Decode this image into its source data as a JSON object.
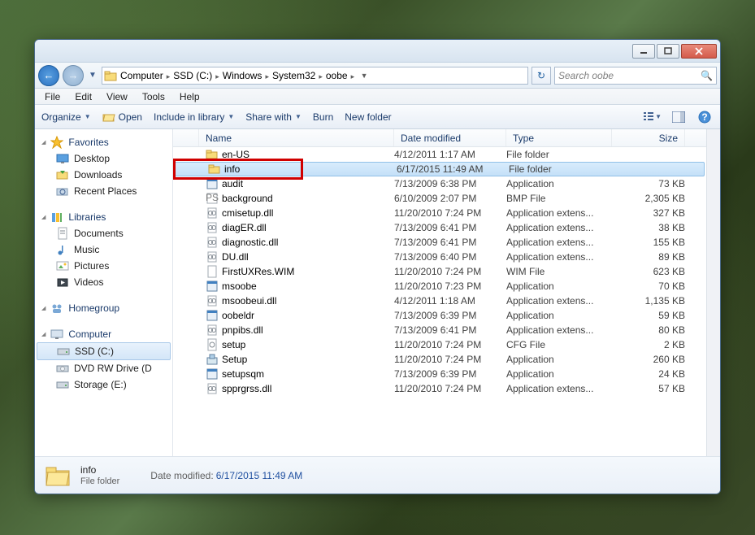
{
  "breadcrumb": [
    "Computer",
    "SSD (C:)",
    "Windows",
    "System32",
    "oobe"
  ],
  "search": {
    "placeholder": "Search oobe"
  },
  "menu": [
    "File",
    "Edit",
    "View",
    "Tools",
    "Help"
  ],
  "toolbar": {
    "organize": "Organize",
    "open": "Open",
    "include": "Include in library",
    "share": "Share with",
    "burn": "Burn",
    "newfolder": "New folder"
  },
  "columns": {
    "name": "Name",
    "date": "Date modified",
    "type": "Type",
    "size": "Size"
  },
  "sidebar": {
    "favorites": {
      "label": "Favorites",
      "items": [
        {
          "label": "Desktop",
          "icon": "desktop"
        },
        {
          "label": "Downloads",
          "icon": "downloads"
        },
        {
          "label": "Recent Places",
          "icon": "recent"
        }
      ]
    },
    "libraries": {
      "label": "Libraries",
      "items": [
        {
          "label": "Documents",
          "icon": "documents"
        },
        {
          "label": "Music",
          "icon": "music"
        },
        {
          "label": "Pictures",
          "icon": "pictures"
        },
        {
          "label": "Videos",
          "icon": "videos"
        }
      ]
    },
    "homegroup": {
      "label": "Homegroup"
    },
    "computer": {
      "label": "Computer",
      "items": [
        {
          "label": "SSD (C:)",
          "icon": "drive",
          "selected": true
        },
        {
          "label": "DVD RW Drive (D",
          "icon": "dvd"
        },
        {
          "label": "Storage (E:)",
          "icon": "drive"
        }
      ]
    }
  },
  "files": [
    {
      "name": "en-US",
      "date": "4/12/2011 1:17 AM",
      "type": "File folder",
      "size": "",
      "icon": "folder"
    },
    {
      "name": "info",
      "date": "6/17/2015 11:49 AM",
      "type": "File folder",
      "size": "",
      "icon": "folder",
      "selected": true
    },
    {
      "name": "audit",
      "date": "7/13/2009 6:38 PM",
      "type": "Application",
      "size": "73 KB",
      "icon": "app"
    },
    {
      "name": "background",
      "date": "6/10/2009 2:07 PM",
      "type": "BMP File",
      "size": "2,305 KB",
      "icon": "bmp"
    },
    {
      "name": "cmisetup.dll",
      "date": "11/20/2010 7:24 PM",
      "type": "Application extens...",
      "size": "327 KB",
      "icon": "dll"
    },
    {
      "name": "diagER.dll",
      "date": "7/13/2009 6:41 PM",
      "type": "Application extens...",
      "size": "38 KB",
      "icon": "dll"
    },
    {
      "name": "diagnostic.dll",
      "date": "7/13/2009 6:41 PM",
      "type": "Application extens...",
      "size": "155 KB",
      "icon": "dll"
    },
    {
      "name": "DU.dll",
      "date": "7/13/2009 6:40 PM",
      "type": "Application extens...",
      "size": "89 KB",
      "icon": "dll"
    },
    {
      "name": "FirstUXRes.WIM",
      "date": "11/20/2010 7:24 PM",
      "type": "WIM File",
      "size": "623 KB",
      "icon": "file"
    },
    {
      "name": "msoobe",
      "date": "11/20/2010 7:23 PM",
      "type": "Application",
      "size": "70 KB",
      "icon": "app"
    },
    {
      "name": "msoobeui.dll",
      "date": "4/12/2011 1:18 AM",
      "type": "Application extens...",
      "size": "1,135 KB",
      "icon": "dll"
    },
    {
      "name": "oobeldr",
      "date": "7/13/2009 6:39 PM",
      "type": "Application",
      "size": "59 KB",
      "icon": "app"
    },
    {
      "name": "pnpibs.dll",
      "date": "7/13/2009 6:41 PM",
      "type": "Application extens...",
      "size": "80 KB",
      "icon": "dll"
    },
    {
      "name": "setup",
      "date": "11/20/2010 7:24 PM",
      "type": "CFG File",
      "size": "2 KB",
      "icon": "cfg"
    },
    {
      "name": "Setup",
      "date": "11/20/2010 7:24 PM",
      "type": "Application",
      "size": "260 KB",
      "icon": "setup"
    },
    {
      "name": "setupsqm",
      "date": "7/13/2009 6:39 PM",
      "type": "Application",
      "size": "24 KB",
      "icon": "app"
    },
    {
      "name": "spprgrss.dll",
      "date": "11/20/2010 7:24 PM",
      "type": "Application extens...",
      "size": "57 KB",
      "icon": "dll"
    }
  ],
  "details": {
    "name": "info",
    "type": "File folder",
    "modlabel": "Date modified:",
    "modvalue": "6/17/2015 11:49 AM"
  }
}
